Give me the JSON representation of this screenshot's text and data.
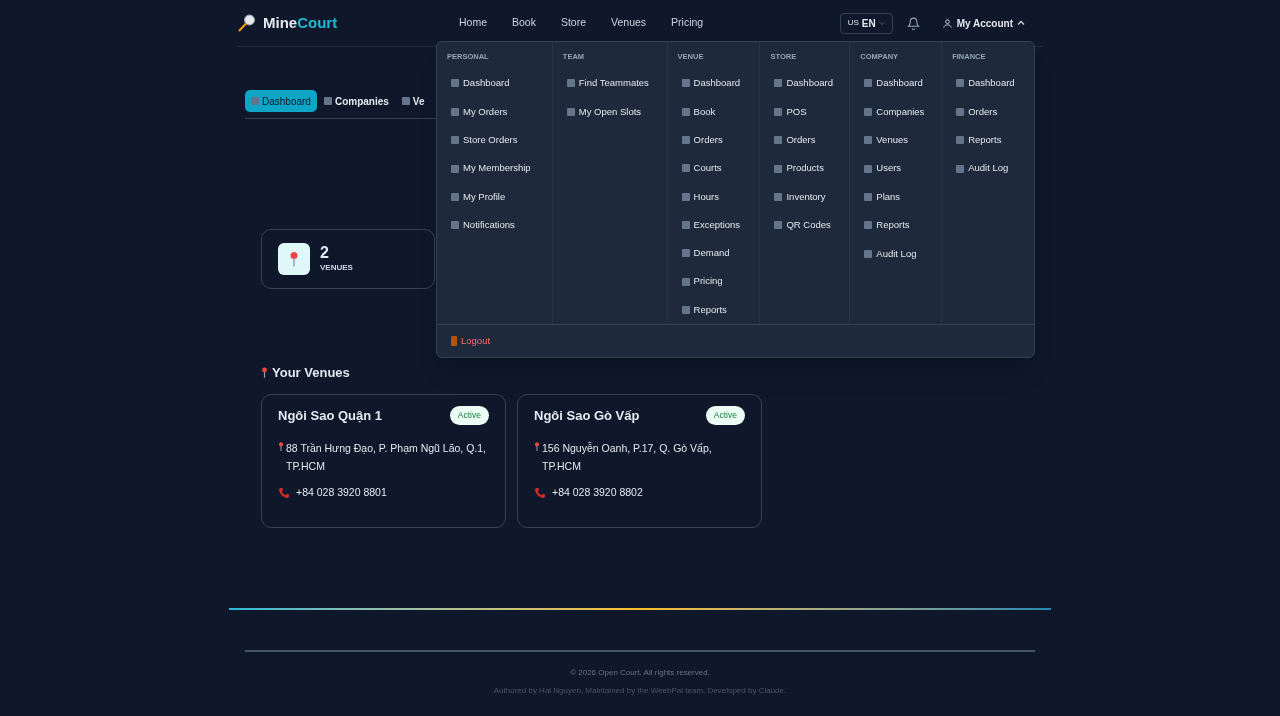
{
  "header": {
    "logo": {
      "text": "Mine",
      "accent": "Court"
    },
    "nav": [
      "Home",
      "Book",
      "Store",
      "Venues",
      "Pricing"
    ],
    "language": {
      "flag": "US",
      "code": "EN"
    },
    "account": {
      "label": "My Account",
      "expanded": true
    }
  },
  "menu": {
    "columns": [
      {
        "title": "PERSONAL",
        "items": [
          "Dashboard",
          "My Orders",
          "Store Orders",
          "My Membership",
          "My Profile",
          "Notifications"
        ]
      },
      {
        "title": "TEAM",
        "items": [
          "Find Teammates",
          "My Open Slots"
        ]
      },
      {
        "title": "VENUE",
        "items": [
          "Dashboard",
          "Book",
          "Orders",
          "Courts",
          "Hours",
          "Exceptions",
          "Demand",
          "Pricing",
          "Reports"
        ]
      },
      {
        "title": "STORE",
        "items": [
          "Dashboard",
          "POS",
          "Orders",
          "Products",
          "Inventory",
          "QR Codes"
        ]
      },
      {
        "title": "COMPANY",
        "items": [
          "Dashboard",
          "Companies",
          "Venues",
          "Users",
          "Plans",
          "Reports",
          "Audit Log"
        ]
      },
      {
        "title": "FINANCE",
        "items": [
          "Dashboard",
          "Orders",
          "Reports",
          "Audit Log"
        ]
      }
    ],
    "logout": "Logout"
  },
  "tabs": [
    {
      "label": "Dashboard",
      "selected": true
    },
    {
      "label": "Companies",
      "selected": false
    },
    {
      "label": "Ve",
      "selected": false
    }
  ],
  "stat": {
    "value": "2",
    "label": "VENUES"
  },
  "venues_heading": "Your Venues",
  "venues": [
    {
      "name": "Ngôi Sao Quận 1",
      "status": "Active",
      "address": "88 Trần Hưng Đạo, P. Phạm Ngũ Lão, Q.1, TP.HCM",
      "phone": "+84 028 3920 8801"
    },
    {
      "name": "Ngôi Sao Gò Vấp",
      "status": "Active",
      "address": "156 Nguyễn Oanh, P.17, Q. Gò Vấp, TP.HCM",
      "phone": "+84 028 3920 8802"
    }
  ],
  "footer": {
    "copyright": "© 2026 Open Court. All rights reserved.",
    "credits": "Authored by Hai Nguyen, Maintained by the WeebPal team, Developed by Claude."
  }
}
